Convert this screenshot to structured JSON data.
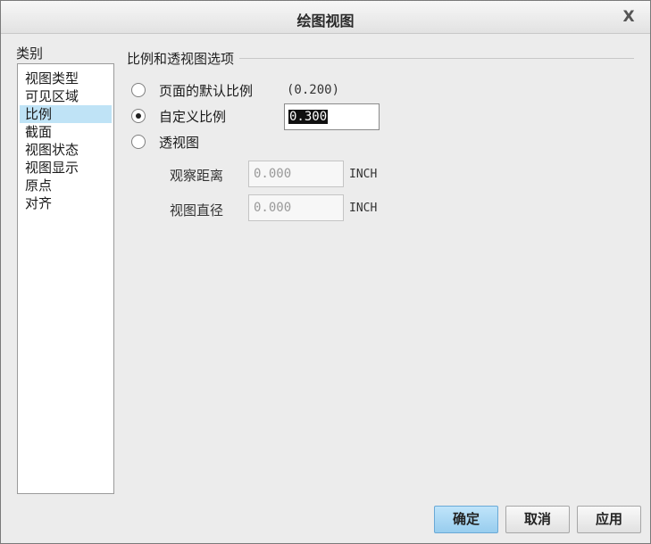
{
  "window": {
    "title": "绘图视图",
    "close_label": "X"
  },
  "categories": {
    "title": "类别",
    "items": [
      "视图类型",
      "可见区域",
      "比例",
      "截面",
      "视图状态",
      "视图显示",
      "原点",
      "对齐"
    ],
    "selected": "比例"
  },
  "scale_group": {
    "title": "比例和透视图选项",
    "options": [
      {
        "label": "页面的默认比例",
        "hint": "(0.200)",
        "checked": false
      },
      {
        "label": "自定义比例",
        "value": "0.300",
        "checked": true
      },
      {
        "label": "透视图",
        "checked": false
      }
    ],
    "observer_distance": {
      "label": "观察距离",
      "placeholder": "0.000",
      "unit": "INCH"
    },
    "view_diameter": {
      "label": "视图直径",
      "placeholder": "0.000",
      "unit": "INCH"
    }
  },
  "buttons": {
    "ok": "确定",
    "cancel": "取消",
    "apply": "应用"
  },
  "colors": {
    "selection": "#bfe3f6",
    "primary_button": "#98cdee"
  }
}
